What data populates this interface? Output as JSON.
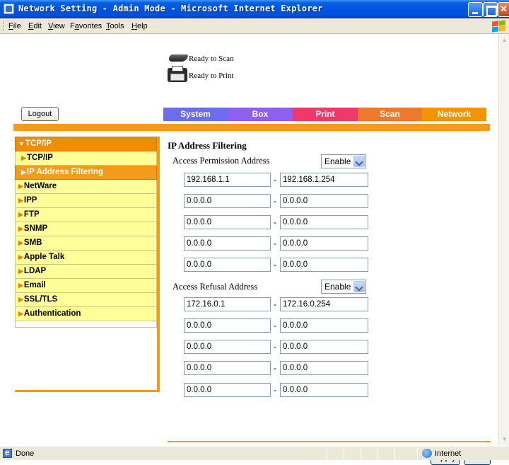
{
  "window": {
    "title": "Network Setting - Admin Mode - Microsoft Internet Explorer"
  },
  "menubar": {
    "items": [
      {
        "label": "File",
        "mnemonic": "F"
      },
      {
        "label": "Edit",
        "mnemonic": "E"
      },
      {
        "label": "View",
        "mnemonic": "V"
      },
      {
        "label": "Favorites",
        "mnemonic": "a"
      },
      {
        "label": "Tools",
        "mnemonic": "T"
      },
      {
        "label": "Help",
        "mnemonic": "H"
      }
    ]
  },
  "device_status": {
    "scan": "Ready to Scan",
    "print": "Ready to Print"
  },
  "logout_label": "Logout",
  "tabs": [
    {
      "label": "System",
      "color": "#6c6cf0"
    },
    {
      "label": "Box",
      "color": "#8f5ff0"
    },
    {
      "label": "Print",
      "color": "#f0386a"
    },
    {
      "label": "Scan",
      "color": "#f0782a"
    },
    {
      "label": "Network",
      "color": "#f59400"
    }
  ],
  "sidenav": {
    "group": "TCP/IP",
    "sub_items": [
      "TCP/IP",
      "IP Address Filtering"
    ],
    "active": "IP Address Filtering",
    "items": [
      "NetWare",
      "IPP",
      "FTP",
      "SNMP",
      "SMB",
      "Apple Talk",
      "LDAP",
      "Email",
      "SSL/TLS",
      "Authentication"
    ]
  },
  "main": {
    "title": "IP Address Filtering",
    "permission": {
      "label": "Access Permission Address",
      "mode": "Enable",
      "ranges": [
        {
          "start": "192.168.1.1",
          "end": "192.168.1.254"
        },
        {
          "start": "0.0.0.0",
          "end": "0.0.0.0"
        },
        {
          "start": "0.0.0.0",
          "end": "0.0.0.0"
        },
        {
          "start": "0.0.0.0",
          "end": "0.0.0.0"
        },
        {
          "start": "0.0.0.0",
          "end": "0.0.0.0"
        }
      ]
    },
    "refusal": {
      "label": "Access Refusal Address",
      "mode": "Enable",
      "ranges": [
        {
          "start": "172.16.0.1",
          "end": "172.16.0.254"
        },
        {
          "start": "0.0.0.0",
          "end": "0.0.0.0"
        },
        {
          "start": "0.0.0.0",
          "end": "0.0.0.0"
        },
        {
          "start": "0.0.0.0",
          "end": "0.0.0.0"
        },
        {
          "start": "0.0.0.0",
          "end": "0.0.0.0"
        }
      ]
    },
    "apply_label": "Apply",
    "clear_label": "Clear"
  },
  "statusbar": {
    "text": "Done",
    "zone": "Internet"
  }
}
